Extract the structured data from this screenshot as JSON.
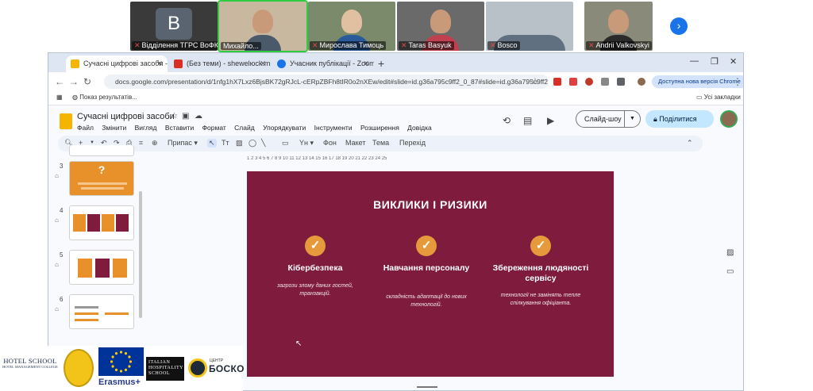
{
  "zoom": {
    "participants": [
      {
        "name": "Відділення ТГРС ВоФК...",
        "avatar_letter": "B"
      },
      {
        "name": "Михайло...",
        "avatar_letter": ""
      },
      {
        "name": "Мирослава Тимоць",
        "avatar_letter": ""
      },
      {
        "name": "Taras Basyuk",
        "avatar_letter": ""
      },
      {
        "name": "Bosco",
        "avatar_letter": ""
      },
      {
        "name": "Andrii Valkovskyi",
        "avatar_letter": ""
      }
    ],
    "next_glyph": "›"
  },
  "browser": {
    "tabs": [
      {
        "label": "Сучасні цифрові засоби - Goo",
        "color": "#f4b400"
      },
      {
        "label": "(Без теми) - shewelюck.mih@g",
        "color": "#d93025"
      },
      {
        "label": "Учасник публікації - Zoom",
        "color": "#1a73e8"
      }
    ],
    "url": "docs.google.com/presentation/d/1nfg1hX7Lxz6BjsBK72gRJcL-cERpZBFh8tIR0o2nXEw/edit#slide=id.g36a795c9ff2_0_87#slide=id.g36a795c9ff2_0_87",
    "update_label": "Доступна нова версія Chrome",
    "bookmark_label": "Показ результатів...",
    "all_bookmarks_label": "Усі закладки"
  },
  "slides_app": {
    "doc_title": "Сучасні цифрові засоби",
    "menu": [
      "Файл",
      "Змінити",
      "Вигляд",
      "Вставити",
      "Формат",
      "Слайд",
      "Упорядкувати",
      "Інструменти",
      "Розширення",
      "Довідка"
    ],
    "slideshow_label": "Слайд-шоу",
    "share_label": "Поділитися",
    "toolbar": {
      "snap_label": "Припас",
      "background_label": "Фон",
      "layout_label": "Макет",
      "theme_label": "Тема",
      "transition_label": "Перехід"
    },
    "filmstrip": {
      "numbers": [
        "3",
        "4",
        "5",
        "6"
      ],
      "thumb3_glyph": "?"
    },
    "ruler_text": "1   2   3   4   5   6   7   8   9   10   11   12   13   14   15   16   17   18   19   20   21   22   23   24   25"
  },
  "slide": {
    "title": "ВИКЛИКИ І РИЗИКИ",
    "check_glyph": "✓",
    "columns": [
      {
        "heading": "Кібербезпека",
        "text": "загрози злому даних гостей, транзакцій."
      },
      {
        "heading": "Навчання персоналу",
        "text": "складність адаптації до нових технологій."
      },
      {
        "heading": "Збереження людяності сервісу",
        "text": "технології не замінять тепле спілкування офіціанта."
      }
    ],
    "colors": {
      "background": "#7f1c3e",
      "accent": "#e69a3c"
    }
  },
  "logos": {
    "hotel_school": "HOTEL SCHOOL",
    "hotel_school_sub": "HOTEL MANAGEMENT COLLEGE",
    "erasmus": "Erasmus+",
    "ihs_lines": "ITALIAN HOSPITALITY SCHOOL",
    "bosko_small": "ЦЕНТР",
    "bosko": "БОСКО"
  }
}
